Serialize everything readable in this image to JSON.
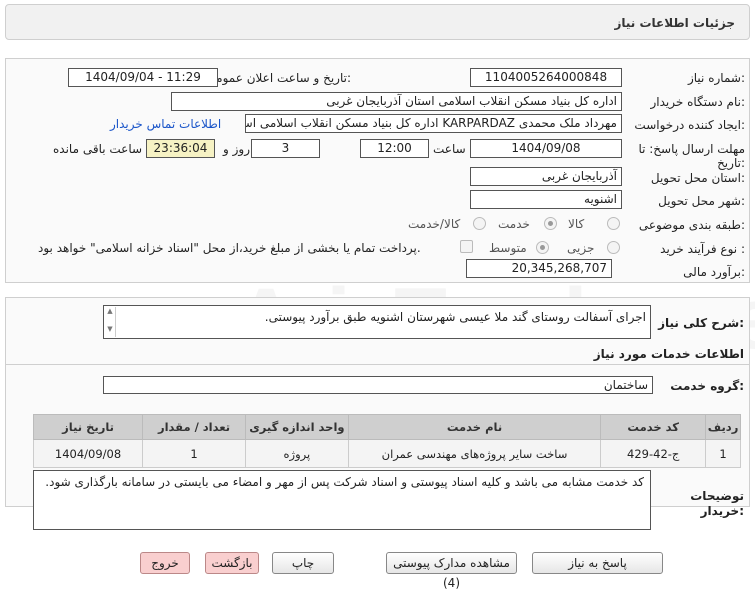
{
  "page_title": "جزئیات اطلاعات نیاز",
  "need_number": {
    "label": "شماره نیاز:",
    "value": "1104005264000848"
  },
  "announce_datetime": {
    "label": "تاریخ و ساعت اعلان عمومی:",
    "value": "1404/09/04 - 11:29"
  },
  "buyer_org": {
    "label": "نام دستگاه خریدار:",
    "value": "اداره کل بنیاد مسکن انقلاب اسلامی استان آذربایجان غربی"
  },
  "requester": {
    "label": "ایجاد کننده درخواست:",
    "value": "مهرداد ملک محمدی KARPARDAZ اداره کل بنیاد مسکن انقلاب اسلامی استان آذ",
    "contact_link": "اطلاعات تماس خریدار"
  },
  "deadline": {
    "label": "مهلت ارسال پاسخ: تا تاریخ:",
    "date": "1404/09/08",
    "time_label": "ساعت",
    "time": "12:00",
    "days": "3",
    "days_label": "روز و",
    "remaining": "23:36:04",
    "remaining_label": "ساعت باقی مانده"
  },
  "province": {
    "label": "استان محل تحویل:",
    "value": "آذربایجان غربی"
  },
  "city": {
    "label": "شهر محل تحویل:",
    "value": "اشنویه"
  },
  "category": {
    "label": "طبقه بندی موضوعی:",
    "options": [
      "کالا",
      "خدمت",
      "کالا/خدمت"
    ],
    "selected": "خدمت"
  },
  "process": {
    "label": "نوع فرآیند خرید :",
    "options": [
      "جزیی",
      "متوسط"
    ],
    "selected": "متوسط",
    "note": "پرداخت تمام یا بخشی از مبلغ خرید،از محل \"اسناد خزانه اسلامی\" خواهد بود."
  },
  "budget": {
    "label": "برآورد مالی:",
    "value": "20,345,268,707"
  },
  "summary": {
    "label": "شرح کلی نیاز:",
    "value": "اجرای آسفالت روستای گند ملا عیسی شهرستان اشنویه طبق برآورد پیوستی."
  },
  "services_title": "اطلاعات خدمات مورد نیاز",
  "service_group": {
    "label": "گروه خدمت:",
    "value": "ساختمان"
  },
  "table": {
    "headers": [
      "ردیف",
      "کد خدمت",
      "نام خدمت",
      "واحد اندازه گیری",
      "تعداد / مقدار",
      "تاریخ نیاز"
    ],
    "rows": [
      [
        "1",
        "ج-42-429",
        "ساخت سایر پروژه‌های مهندسی عمران",
        "پروژه",
        "1",
        "1404/09/08"
      ]
    ]
  },
  "buyer_notes": {
    "label": "توضیحات خریدار:",
    "value": "کد خدمت مشابه می باشد و کلیه اسناد پیوستی و اسناد شرکت پس از مهر و امضاء می بایستی در سامانه بارگذاری شود."
  },
  "buttons": {
    "reply": "پاسخ به نیاز",
    "attachments": "مشاهده مدارک پیوستی (4)",
    "print": "چاپ",
    "back": "بازگشت",
    "exit": "خروج"
  }
}
